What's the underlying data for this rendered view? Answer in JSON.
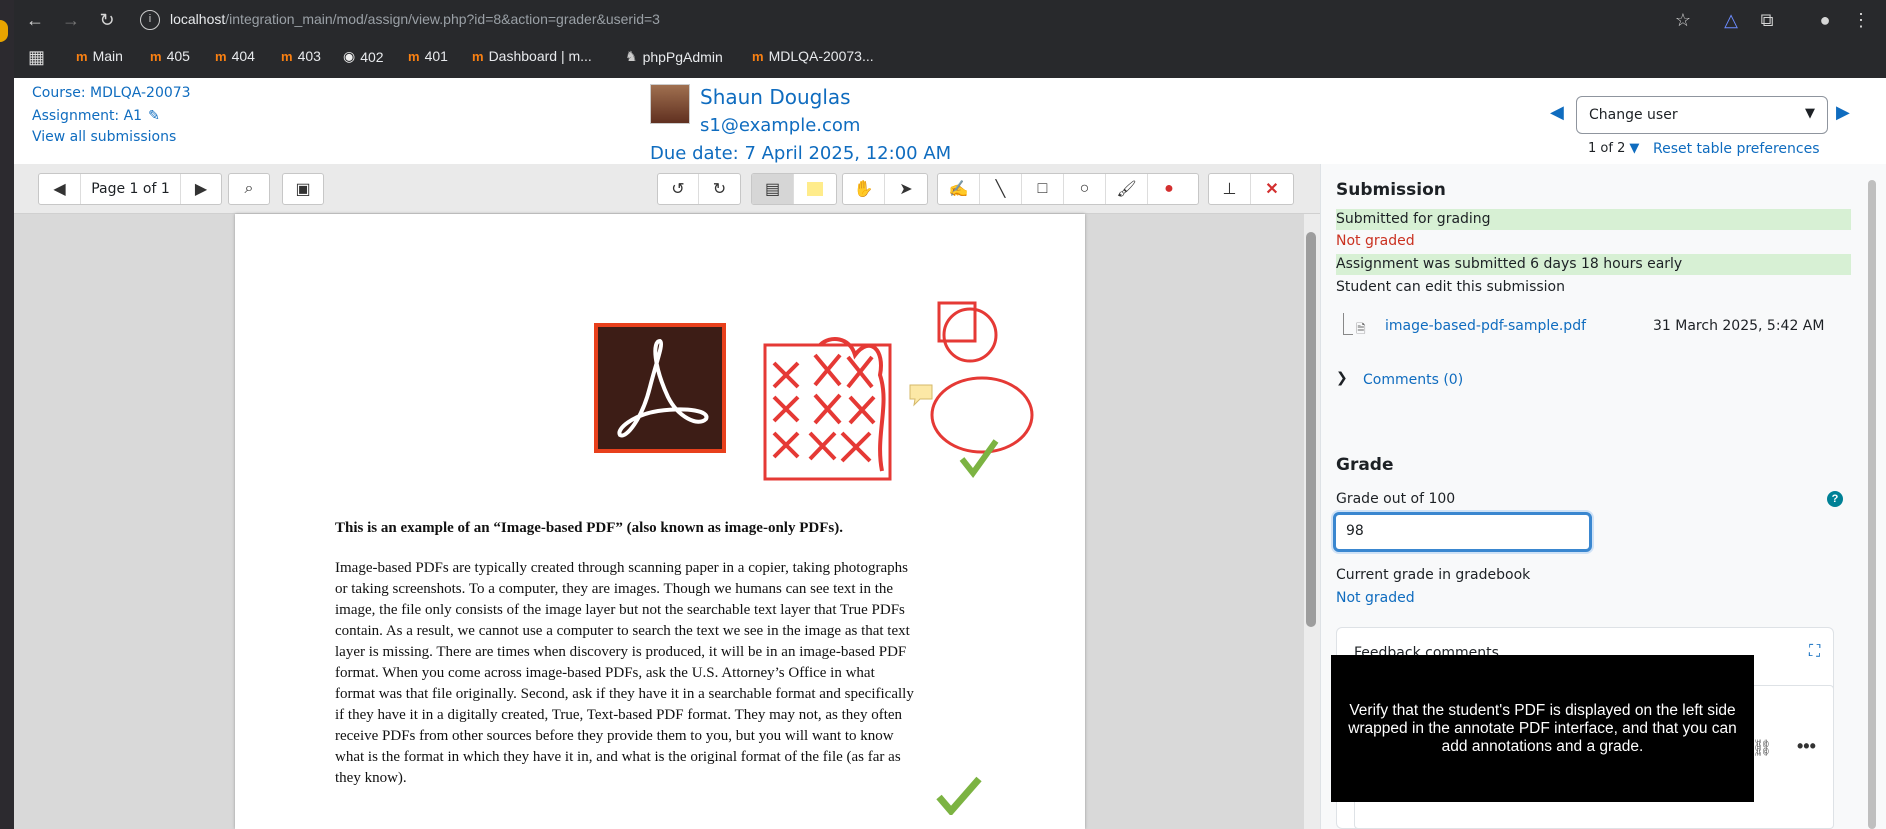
{
  "browser": {
    "url_host": "localhost",
    "url_path": "/integration_main/mod/assign/view.php?id=8&action=grader&userid=3",
    "bookmarks": [
      "Main",
      "405",
      "404",
      "403",
      "402",
      "401",
      "Dashboard | m...",
      "phpPgAdmin",
      "MDLQA-20073..."
    ]
  },
  "header": {
    "course": "Course: MDLQA-20073",
    "assignment": "Assignment: A1",
    "view_all": "View all submissions",
    "user_name": "Shaun Douglas",
    "user_email": "s1@example.com",
    "due_date": "Due date: 7 April 2025, 12:00 AM",
    "change_user": "Change user",
    "count": "1 of 2",
    "reset": "Reset table preferences"
  },
  "toolbar": {
    "page_label": "Page 1 of 1"
  },
  "pdf": {
    "heading": "This is an example of an “Image-based PDF” (also known as image-only PDFs).",
    "body_lines": [
      "Image-based PDFs are typically created through scanning paper in a copier, taking photographs",
      "or taking screenshots. To a computer, they are images. Though we humans can see text in the",
      "image, the file only consists of the image layer but not the searchable text layer that True PDFs",
      "contain. As a result, we cannot use a computer to search the text we see in the image as that text",
      "layer is missing. There are times when discovery is produced, it will be in an image-based PDF",
      "format. When you come across image-based PDFs, ask the U.S. Attorney’s Office in what",
      "format was that file originally. Second, ask if they have it in a searchable format and specifically",
      "if they have it in a digitally created, True, Text-based PDF format. They may not, as they often",
      "receive PDFs from other sources before they provide them to you, but you will want to know",
      "what is the format in which they have it in, and what is the original format of the file (as far as",
      "they know)."
    ]
  },
  "submission": {
    "title": "Submission",
    "status": "Submitted for grading",
    "grading": "Not graded",
    "early": "Assignment was submitted 6 days 18 hours early",
    "edit": "Student can edit this submission",
    "file_name": "image-based-pdf-sample.pdf",
    "file_date": "31 March 2025, 5:42 AM",
    "comments": "Comments (0)"
  },
  "grade": {
    "title": "Grade",
    "label": "Grade out of 100",
    "value": "98",
    "current_label": "Current grade in gradebook",
    "current_value": "Not graded",
    "feedback_label": "Feedback comments"
  },
  "tooltip": "Verify that the student's PDF is displayed on the left side wrapped in the annotate PDF interface, and that you can add annotations and a grade.",
  "colors": {
    "link": "#0f6cbf",
    "annotation": "#e53935",
    "check": "#7cb342",
    "error": "#ca3120"
  }
}
